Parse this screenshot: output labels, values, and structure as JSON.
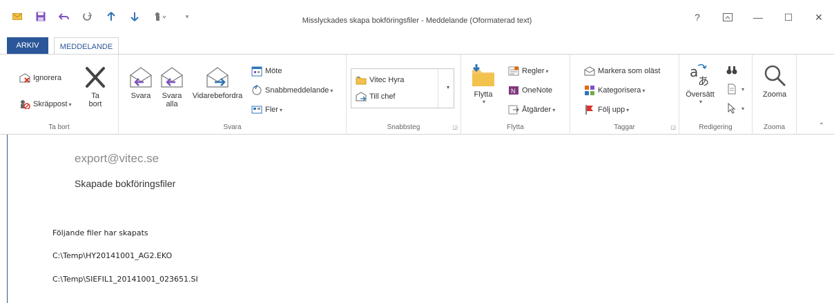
{
  "window": {
    "title": "Misslyckades skapa bokföringsfiler - Meddelande (Oformaterad text)",
    "help": "?",
    "minimize": "—",
    "maximize": "☐",
    "close": "✕"
  },
  "tabs": {
    "arkiv": "ARKIV",
    "meddelande": "MEDDELANDE"
  },
  "groups": {
    "tabort": {
      "label": "Ta bort",
      "ignorera": "Ignorera",
      "skrappost": "Skräppost",
      "ta_bort_line1": "Ta",
      "ta_bort_line2": "bort"
    },
    "svara": {
      "label": "Svara",
      "svara": "Svara",
      "svara_alla_line1": "Svara",
      "svara_alla_line2": "alla",
      "vidarebefordra": "Vidarebefordra",
      "mote": "Möte",
      "snabbmeddelande": "Snabbmeddelande",
      "fler": "Fler"
    },
    "snabbsteg": {
      "label": "Snabbsteg",
      "item1": "Vitec Hyra",
      "item2": "Till chef"
    },
    "flytta": {
      "label": "Flytta",
      "flytta": "Flytta",
      "regler": "Regler",
      "onenote": "OneNote",
      "atgarder": "Åtgärder"
    },
    "taggar": {
      "label": "Taggar",
      "markera": "Markera som oläst",
      "kategorisera": "Kategorisera",
      "folj_upp": "Följ upp"
    },
    "redigering": {
      "label": "Redigering",
      "oversatt": "Översätt"
    },
    "zooma": {
      "label": "Zooma",
      "zooma": "Zooma"
    }
  },
  "message": {
    "sender": "export@vitec.se",
    "subject": "Skapade bokföringsfiler",
    "lines": [
      "Följande filer har skapats",
      "C:\\Temp\\HY20141001_AG2.EKO",
      "C:\\Temp\\SIEFIL1_20141001_023651.SI"
    ]
  },
  "colors": {
    "accent": "#2b579a",
    "purple": "#7f52c1",
    "blue": "#2e75b6"
  }
}
